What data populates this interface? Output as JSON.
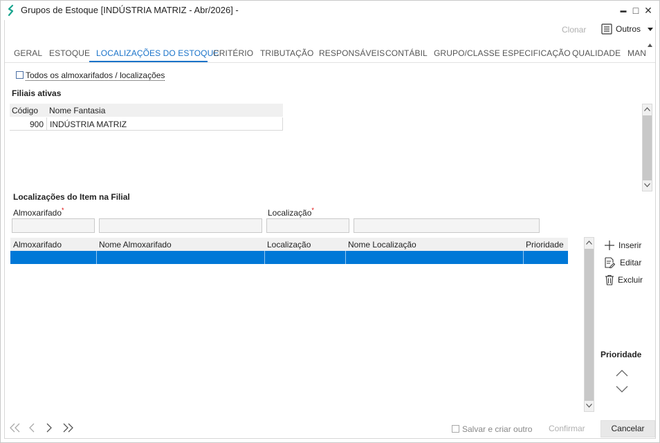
{
  "window": {
    "title": "Grupos de Estoque [INDÚSTRIA MATRIZ - Abr/2026]  -",
    "minimize": "▬",
    "maximize": "□",
    "close": "✕"
  },
  "toolbar": {
    "clonar_label": "Clonar",
    "outros_label": "Outros"
  },
  "tabs": [
    {
      "label": "GERAL"
    },
    {
      "label": "ESTOQUE"
    },
    {
      "label": "LOCALIZAÇÕES DO ESTOQUE"
    },
    {
      "label": "CRITÉRIO"
    },
    {
      "label": "TRIBUTAÇÃO"
    },
    {
      "label": "RESPONSÁVEIS"
    },
    {
      "label": "CONTÁBIL"
    },
    {
      "label": "GRUPO/CLASSE"
    },
    {
      "label": "ESPECIFICAÇÃO"
    },
    {
      "label": "QUALIDADE"
    },
    {
      "label": "MAN"
    }
  ],
  "all_locations": {
    "label": "Todos os almoxarifados / localizações",
    "checked": false
  },
  "filiais": {
    "title": "Filiais ativas",
    "columns": [
      "Código",
      "Nome Fantasia"
    ],
    "rows": [
      {
        "codigo": "900",
        "nome": "INDÚSTRIA MATRIZ"
      }
    ]
  },
  "localizacoes": {
    "title": "Localizações do Item na Filial",
    "almoxarifado_label": "Almoxarifado",
    "localizacao_label": "Localização",
    "required_mark": "*",
    "almoxarifado_code_value": "",
    "almoxarifado_name_value": "",
    "localizacao_code_value": "",
    "localizacao_name_value": "",
    "columns": [
      "Almoxarifado",
      "Nome Almoxarifado",
      "Localização",
      "Nome Localização",
      "Prioridade"
    ],
    "rows": [
      {
        "almoxarifado": "",
        "nome_almoxarifado": "",
        "localizacao": "",
        "nome_localizacao": "",
        "prioridade": "",
        "selected": true
      }
    ]
  },
  "side_actions": {
    "inserir": "Inserir",
    "editar": "Editar",
    "excluir": "Excluir",
    "prioridade_title": "Prioridade"
  },
  "footer": {
    "salvar_label": "Salvar e criar outro",
    "confirmar_label": "Confirmar",
    "cancelar_label": "Cancelar"
  },
  "colors": {
    "accent": "#1a73c9",
    "selection": "#0078d7",
    "logo": "#1aa58f"
  }
}
